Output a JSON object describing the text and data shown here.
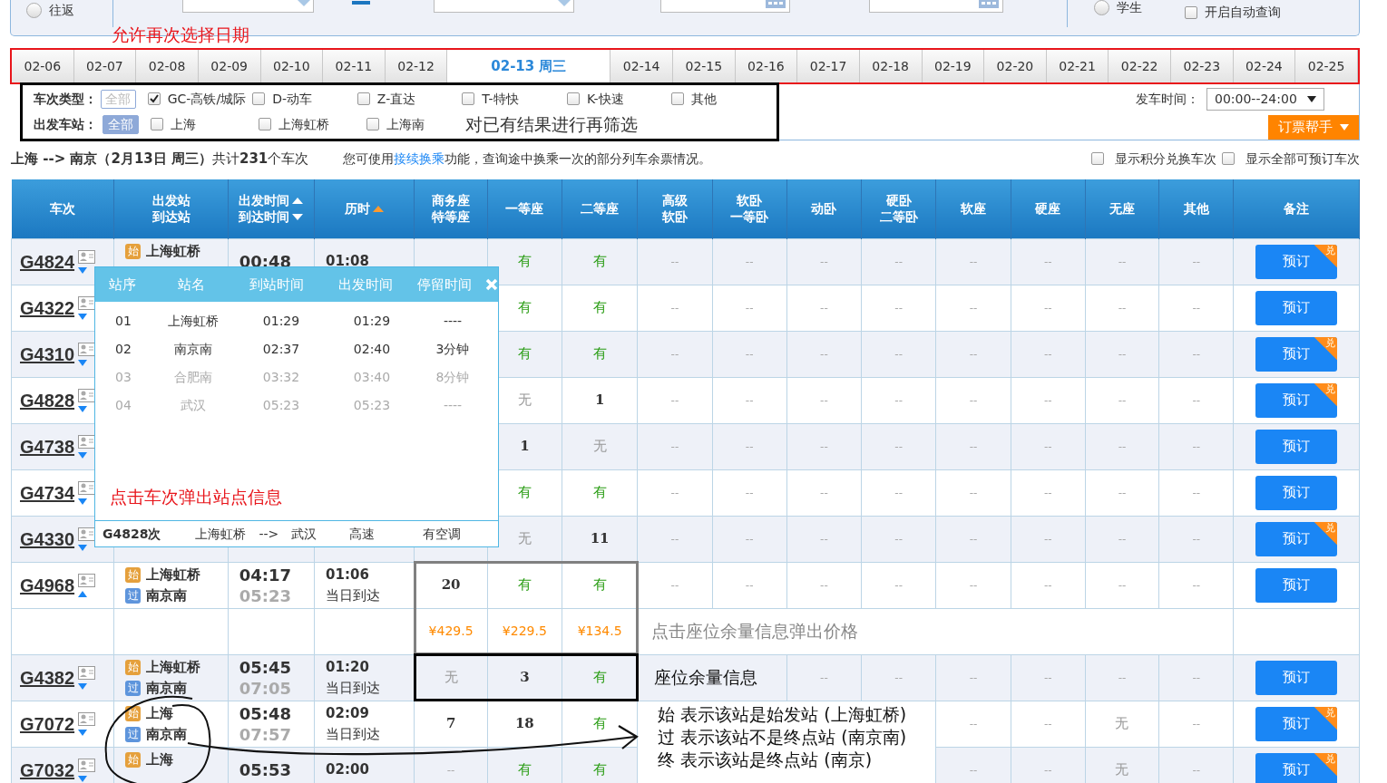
{
  "search_bar": {
    "trip_type": {
      "label": "往返",
      "selected": false
    },
    "passenger_type": {
      "label": "学生",
      "selected": false
    },
    "auto_query": {
      "label": "开启自动查询",
      "checked": false
    }
  },
  "date_note": "允许再次选择日期",
  "date_tabs": [
    {
      "label": "02-06",
      "selected": false
    },
    {
      "label": "02-07",
      "selected": false
    },
    {
      "label": "02-08",
      "selected": false
    },
    {
      "label": "02-09",
      "selected": false
    },
    {
      "label": "02-10",
      "selected": false
    },
    {
      "label": "02-11",
      "selected": false
    },
    {
      "label": "02-12",
      "selected": false
    },
    {
      "label": "02-13",
      "weekday": "周三",
      "selected": true
    },
    {
      "label": "02-14",
      "selected": false
    },
    {
      "label": "02-15",
      "selected": false
    },
    {
      "label": "02-16",
      "selected": false
    },
    {
      "label": "02-17",
      "selected": false
    },
    {
      "label": "02-18",
      "selected": false
    },
    {
      "label": "02-19",
      "selected": false
    },
    {
      "label": "02-20",
      "selected": false
    },
    {
      "label": "02-21",
      "selected": false
    },
    {
      "label": "02-22",
      "selected": false
    },
    {
      "label": "02-23",
      "selected": false
    },
    {
      "label": "02-24",
      "selected": false
    },
    {
      "label": "02-25",
      "selected": false
    }
  ],
  "filters": {
    "groups": [
      {
        "label": "车次类型：",
        "all": "全部",
        "all_selected": false,
        "options": [
          {
            "label": "GC-高铁/城际",
            "checked": true
          },
          {
            "label": "D-动车",
            "checked": false
          },
          {
            "label": "Z-直达",
            "checked": false
          },
          {
            "label": "T-特快",
            "checked": false
          },
          {
            "label": "K-快速",
            "checked": false
          },
          {
            "label": "其他",
            "checked": false
          }
        ]
      },
      {
        "label": "出发车站：",
        "all": "全部",
        "all_selected": true,
        "options": [
          {
            "label": "上海",
            "checked": false
          },
          {
            "label": "上海虹桥",
            "checked": false
          },
          {
            "label": "上海南",
            "checked": false
          }
        ],
        "note": "对已有结果进行再筛选"
      }
    ],
    "departure_time": {
      "label": "发车时间：",
      "value": "00:00--24:00"
    },
    "helper_button": "订票帮手"
  },
  "summary": {
    "text": "**上海 --> 南京（2月13日  周三）**共计**231**个车次",
    "hint_before": "您可使用",
    "hint_link": "接续换乘",
    "hint_after": "功能，查询途中换乘一次的部分列车余票情况。",
    "options": [
      {
        "label": "显示积分兑换车次",
        "checked": false
      },
      {
        "label": "显示全部可预订车次",
        "checked": false
      }
    ]
  },
  "table": {
    "columns": [
      {
        "lines": [
          "车次"
        ]
      },
      {
        "lines": [
          "出发站",
          "到达站"
        ]
      },
      {
        "lines": [
          "出发时间",
          "到达时间"
        ],
        "sort_icons": [
          {
            "kind": "up",
            "active": false
          },
          {
            "kind": "down",
            "active": false
          }
        ]
      },
      {
        "lines": [
          "历时"
        ],
        "sort_icons": [
          {
            "kind": "up",
            "active": true
          }
        ]
      },
      {
        "lines": [
          "商务座",
          "特等座"
        ]
      },
      {
        "lines": [
          "一等座"
        ]
      },
      {
        "lines": [
          "二等座"
        ]
      },
      {
        "lines": [
          "高级",
          "软卧"
        ]
      },
      {
        "lines": [
          "软卧",
          "一等卧"
        ]
      },
      {
        "lines": [
          "动卧"
        ]
      },
      {
        "lines": [
          "硬卧",
          "二等卧"
        ]
      },
      {
        "lines": [
          "软座"
        ]
      },
      {
        "lines": [
          "硬座"
        ]
      },
      {
        "lines": [
          "无座"
        ]
      },
      {
        "lines": [
          "其他"
        ]
      },
      {
        "lines": [
          "备注"
        ]
      }
    ],
    "rows": [
      {
        "kind": "train",
        "train": "G4824",
        "expanded": false,
        "from": {
          "mark": "始",
          "kind": "start",
          "name": "上海虹桥"
        },
        "depart": "00:48",
        "duration": "01:08",
        "seats": [
          {
            "kind": "covered"
          },
          {
            "text": "有",
            "kind": "yes"
          },
          {
            "text": "有",
            "kind": "yes"
          },
          {
            "text": "--",
            "kind": "none"
          },
          {
            "text": "--",
            "kind": "none"
          },
          {
            "text": "--",
            "kind": "none"
          },
          {
            "text": "--",
            "kind": "none"
          },
          {
            "text": "--",
            "kind": "none"
          },
          {
            "text": "--",
            "kind": "none"
          },
          {
            "text": "--",
            "kind": "none"
          },
          {
            "text": "--",
            "kind": "none"
          }
        ],
        "book": "预订",
        "badge": "兑"
      },
      {
        "kind": "train",
        "train": "G4322",
        "expanded": false,
        "seats": [
          {
            "kind": "covered"
          },
          {
            "text": "有",
            "kind": "yes"
          },
          {
            "text": "有",
            "kind": "yes"
          },
          {
            "text": "--",
            "kind": "none"
          },
          {
            "text": "--",
            "kind": "none"
          },
          {
            "text": "--",
            "kind": "none"
          },
          {
            "text": "--",
            "kind": "none"
          },
          {
            "text": "--",
            "kind": "none"
          },
          {
            "text": "--",
            "kind": "none"
          },
          {
            "text": "--",
            "kind": "none"
          },
          {
            "text": "--",
            "kind": "none"
          }
        ],
        "book": "预订"
      },
      {
        "kind": "train",
        "train": "G4310",
        "expanded": false,
        "seats": [
          {
            "kind": "covered"
          },
          {
            "text": "有",
            "kind": "yes"
          },
          {
            "text": "有",
            "kind": "yes"
          },
          {
            "text": "--",
            "kind": "none"
          },
          {
            "text": "--",
            "kind": "none"
          },
          {
            "text": "--",
            "kind": "none"
          },
          {
            "text": "--",
            "kind": "none"
          },
          {
            "text": "--",
            "kind": "none"
          },
          {
            "text": "--",
            "kind": "none"
          },
          {
            "text": "--",
            "kind": "none"
          },
          {
            "text": "--",
            "kind": "none"
          }
        ],
        "book": "预订",
        "badge": "兑"
      },
      {
        "kind": "train",
        "train": "G4828",
        "expanded": false,
        "seats": [
          {
            "kind": "covered"
          },
          {
            "text": "无",
            "kind": "no"
          },
          {
            "text": "1",
            "kind": "count"
          },
          {
            "text": "--",
            "kind": "none"
          },
          {
            "text": "--",
            "kind": "none"
          },
          {
            "text": "--",
            "kind": "none"
          },
          {
            "text": "--",
            "kind": "none"
          },
          {
            "text": "--",
            "kind": "none"
          },
          {
            "text": "--",
            "kind": "none"
          },
          {
            "text": "--",
            "kind": "none"
          },
          {
            "text": "--",
            "kind": "none"
          }
        ],
        "book": "预订",
        "badge": "兑"
      },
      {
        "kind": "train",
        "train": "G4738",
        "expanded": false,
        "seats": [
          {
            "kind": "covered"
          },
          {
            "text": "1",
            "kind": "count"
          },
          {
            "text": "无",
            "kind": "no"
          },
          {
            "text": "--",
            "kind": "none"
          },
          {
            "text": "--",
            "kind": "none"
          },
          {
            "text": "--",
            "kind": "none"
          },
          {
            "text": "--",
            "kind": "none"
          },
          {
            "text": "--",
            "kind": "none"
          },
          {
            "text": "--",
            "kind": "none"
          },
          {
            "text": "--",
            "kind": "none"
          },
          {
            "text": "--",
            "kind": "none"
          }
        ],
        "book": "预订"
      },
      {
        "kind": "train",
        "train": "G4734",
        "expanded": false,
        "seats": [
          {
            "kind": "covered"
          },
          {
            "text": "有",
            "kind": "yes"
          },
          {
            "text": "有",
            "kind": "yes"
          },
          {
            "text": "--",
            "kind": "none"
          },
          {
            "text": "--",
            "kind": "none"
          },
          {
            "text": "--",
            "kind": "none"
          },
          {
            "text": "--",
            "kind": "none"
          },
          {
            "text": "--",
            "kind": "none"
          },
          {
            "text": "--",
            "kind": "none"
          },
          {
            "text": "--",
            "kind": "none"
          },
          {
            "text": "--",
            "kind": "none"
          }
        ],
        "book": "预订"
      },
      {
        "kind": "train",
        "train": "G4330",
        "expanded": false,
        "seats": [
          {
            "kind": "covered"
          },
          {
            "text": "无",
            "kind": "no"
          },
          {
            "text": "11",
            "kind": "count"
          },
          {
            "text": "--",
            "kind": "none"
          },
          {
            "text": "--",
            "kind": "none"
          },
          {
            "text": "--",
            "kind": "none"
          },
          {
            "text": "--",
            "kind": "none"
          },
          {
            "text": "--",
            "kind": "none"
          },
          {
            "text": "--",
            "kind": "none"
          },
          {
            "text": "--",
            "kind": "none"
          },
          {
            "text": "--",
            "kind": "none"
          }
        ],
        "book": "预订",
        "badge": "兑"
      },
      {
        "kind": "train",
        "train": "G4968",
        "expanded": true,
        "from": {
          "mark": "始",
          "kind": "start",
          "name": "上海虹桥"
        },
        "to": {
          "mark": "过",
          "kind": "pass",
          "name": "南京南"
        },
        "depart": "04:17",
        "arrive": "05:23",
        "duration": "01:06",
        "arrival_day": "当日到达",
        "seats": [
          {
            "text": "20",
            "kind": "count"
          },
          {
            "text": "有",
            "kind": "yes"
          },
          {
            "text": "有",
            "kind": "yes"
          },
          {
            "text": "--",
            "kind": "none"
          },
          {
            "text": "--",
            "kind": "none"
          },
          {
            "text": "--",
            "kind": "none"
          },
          {
            "text": "--",
            "kind": "none"
          },
          {
            "text": "--",
            "kind": "none"
          },
          {
            "text": "--",
            "kind": "none"
          },
          {
            "text": "--",
            "kind": "none"
          },
          {
            "text": "--",
            "kind": "none"
          }
        ],
        "book": "预订"
      },
      {
        "kind": "price",
        "framed": true,
        "seats": [
          {
            "text": "¥429.5",
            "kind": "price"
          },
          {
            "text": "¥229.5",
            "kind": "price"
          },
          {
            "text": "¥134.5",
            "kind": "price"
          },
          {
            "text": "点击座位余量信息弹出价格",
            "kind": "note_muted"
          },
          {
            "kind": "merged"
          },
          {
            "kind": "merged"
          },
          {
            "kind": "merged"
          },
          {
            "kind": "merged"
          },
          {
            "kind": "merged"
          },
          {
            "kind": "merged"
          },
          {
            "kind": "merged"
          }
        ]
      },
      {
        "kind": "train",
        "train": "G4382",
        "expanded": false,
        "framed": true,
        "from": {
          "mark": "始",
          "kind": "start",
          "name": "上海虹桥"
        },
        "to": {
          "mark": "过",
          "kind": "pass",
          "name": "南京南"
        },
        "depart": "05:45",
        "arrive": "07:05",
        "duration": "01:20",
        "arrival_day": "当日到达",
        "seats": [
          {
            "text": "无",
            "kind": "no"
          },
          {
            "text": "3",
            "kind": "count"
          },
          {
            "text": "有",
            "kind": "yes"
          },
          {
            "text": "座位余量信息",
            "kind": "note"
          },
          {
            "kind": "merged"
          },
          {
            "text": "--",
            "kind": "none"
          },
          {
            "text": "--",
            "kind": "none"
          },
          {
            "text": "--",
            "kind": "none"
          },
          {
            "text": "--",
            "kind": "none"
          },
          {
            "text": "--",
            "kind": "none"
          },
          {
            "text": "--",
            "kind": "none"
          }
        ],
        "book": "预订"
      },
      {
        "kind": "train",
        "train": "G7072",
        "expanded": false,
        "from": {
          "mark": "始",
          "kind": "start",
          "name": "上海"
        },
        "to": {
          "mark": "过",
          "kind": "pass",
          "name": "南京南"
        },
        "depart": "05:48",
        "arrive": "07:57",
        "duration": "02:09",
        "arrival_day": "当日到达",
        "seats": [
          {
            "text": "7",
            "kind": "count"
          },
          {
            "text": "18",
            "kind": "count"
          },
          {
            "text": "有",
            "kind": "yes"
          },
          {
            "kind": "legend",
            "lines": [
              "始 表示该站是始发站 (上海虹桥)",
              "过 表示该站不是终点站 (南京南)",
              "终 表示该站是终点站 (南京)"
            ]
          },
          {
            "kind": "merged"
          },
          {
            "kind": "merged"
          },
          {
            "kind": "merged"
          },
          {
            "text": "--",
            "kind": "none"
          },
          {
            "text": "--",
            "kind": "none"
          },
          {
            "text": "无",
            "kind": "no"
          },
          {
            "text": "--",
            "kind": "none"
          }
        ],
        "book": "预订",
        "badge": "兑"
      },
      {
        "kind": "train",
        "train": "G7032",
        "expanded": false,
        "from": {
          "mark": "始",
          "kind": "start",
          "name": "上海"
        },
        "depart": "05:53",
        "duration": "02:00",
        "seats": [
          {
            "text": "--",
            "kind": "none"
          },
          {
            "text": "有",
            "kind": "yes"
          },
          {
            "text": "有",
            "kind": "yes"
          },
          {
            "text": "--",
            "kind": "none"
          },
          {
            "text": "--",
            "kind": "none"
          },
          {
            "text": "无",
            "kind": "no"
          },
          {
            "text": "--",
            "kind": "none"
          }
        ],
        "book": "预订",
        "badge": "兑"
      }
    ]
  },
  "popup": {
    "columns": [
      "站序",
      "站名",
      "到站时间",
      "出发时间",
      "停留时间"
    ],
    "stops": [
      {
        "no": "01",
        "name": "上海虹桥",
        "arrive": "01:29",
        "depart": "01:29",
        "stay": "----",
        "in_route": true
      },
      {
        "no": "02",
        "name": "南京南",
        "arrive": "02:37",
        "depart": "02:40",
        "stay": "3分钟",
        "in_route": true
      },
      {
        "no": "03",
        "name": "合肥南",
        "arrive": "03:32",
        "depart": "03:40",
        "stay": "8分钟",
        "in_route": false
      },
      {
        "no": "04",
        "name": "武汉",
        "arrive": "05:23",
        "depart": "05:23",
        "stay": "----",
        "in_route": false
      }
    ],
    "note": "点击车次弹出站点信息",
    "footer": {
      "train": "G4828次",
      "from": "上海虹桥",
      "arrow": "-->",
      "to": "武汉",
      "speed": "高速",
      "facility": "有空调"
    }
  }
}
